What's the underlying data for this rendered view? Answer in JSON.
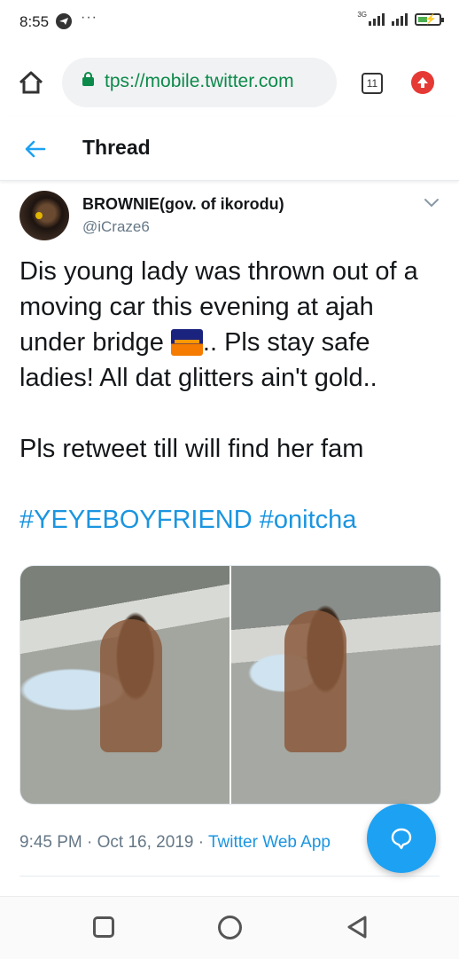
{
  "status_bar": {
    "time": "8:55",
    "icons": [
      "telegram-icon",
      "more-dots-icon"
    ],
    "overflow": "···",
    "network": "3G",
    "battery": {
      "level": 0.45,
      "charging": true,
      "color": "#4caf50"
    }
  },
  "browser": {
    "url": "tps://mobile.twitter.com",
    "tab_count": "11",
    "secure_color": "#0c8a4a",
    "upload_color": "#e53935"
  },
  "header": {
    "title": "Thread"
  },
  "tweet": {
    "display_name": "BROWNIE(gov. of ikorodu)",
    "handle": "@iCraze6",
    "line1": "Dis young lady was thrown out of a moving car this evening at ajah under bridge",
    "line1_emoji": "bridge-at-night-emoji",
    "line2": ".. Pls stay safe ladies! All dat glitters ain't gold..",
    "line3": "Pls retweet till will find her fam",
    "hashtags": "#YEYEBOYFRIEND #onitcha",
    "time": "9:45 PM",
    "separator": "·",
    "date": "Oct 16, 2019",
    "source": "Twitter Web App",
    "link_color": "#1b95e0"
  },
  "media": {
    "photos": [
      "photo-1",
      "photo-2"
    ]
  },
  "fab": {
    "icon": "reply-bubble-icon",
    "color": "#1da1f2"
  },
  "nav": {
    "icons": [
      "recents-square-icon",
      "home-circle-icon",
      "back-triangle-icon"
    ]
  }
}
